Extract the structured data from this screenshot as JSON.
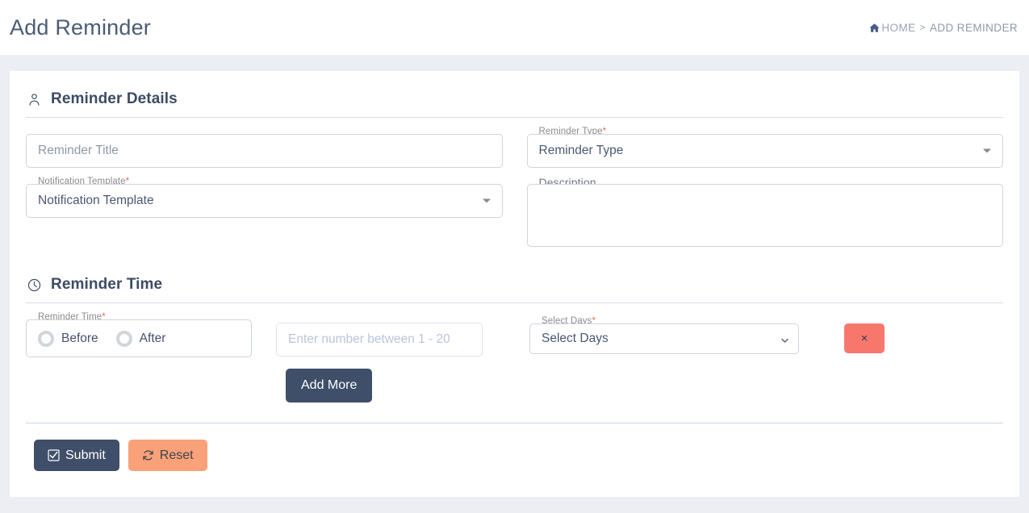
{
  "header": {
    "title": "Add Reminder",
    "breadcrumb": {
      "home_icon": "home-icon",
      "home": "HOME",
      "separator": ">",
      "current": "ADD REMINDER"
    }
  },
  "sections": {
    "details": {
      "icon": "user-icon",
      "title": "Reminder Details",
      "fields": {
        "reminder_title": {
          "placeholder": "Reminder Title",
          "required_mark": "*",
          "value": ""
        },
        "reminder_type": {
          "label": "Reminder Type",
          "required_mark": "*",
          "value": "Reminder Type",
          "arrow_icon": "caret-down-icon"
        },
        "notification_template": {
          "label": "Notification Template",
          "required_mark": "*",
          "value": "Notification Template",
          "arrow_icon": "caret-down-icon"
        },
        "description": {
          "label": "Description",
          "value": ""
        }
      }
    },
    "time": {
      "icon": "clock-icon",
      "title": "Reminder Time",
      "fields": {
        "reminder_time": {
          "label": "Reminder Time",
          "required_mark": "*",
          "options": [
            "Before",
            "After"
          ],
          "selected": ""
        },
        "number": {
          "placeholder": "Enter number between 1 - 20",
          "value": ""
        },
        "select_days": {
          "label": "Select Days",
          "required_mark": "*",
          "value": "Select Days",
          "arrow_icon": "chevron-down-icon"
        },
        "delete_button": {
          "icon": "close-icon",
          "label": "×"
        }
      },
      "add_more_label": "Add More"
    }
  },
  "footer": {
    "submit": {
      "icon": "check-square-icon",
      "label": "Submit"
    },
    "reset": {
      "icon": "refresh-icon",
      "label": "Reset"
    }
  },
  "colors": {
    "page_background": "#eceef3",
    "card_background": "#ffffff",
    "primary_dark": "#3f4e69",
    "reset_orange": "#f9a178",
    "delete_red": "#f7776d",
    "required_red": "#f0675b",
    "title_text": "#4b5c77",
    "border": "#cfd4dd"
  }
}
